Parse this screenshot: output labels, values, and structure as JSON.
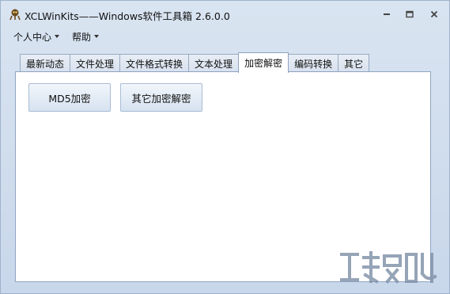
{
  "window": {
    "title": "XCLWinKits——Windows软件工具箱 2.6.0.0"
  },
  "menu": [
    {
      "label": "个人中心"
    },
    {
      "label": "帮助"
    }
  ],
  "tabs": [
    {
      "label": "最新动态"
    },
    {
      "label": "文件处理"
    },
    {
      "label": "文件格式转换"
    },
    {
      "label": "文本处理"
    },
    {
      "label": "加密解密",
      "active": true
    },
    {
      "label": "编码转换"
    },
    {
      "label": "其它"
    }
  ],
  "panel": {
    "buttons": [
      {
        "label": "MD5加密"
      },
      {
        "label": "其它加密解密"
      }
    ]
  },
  "icons": {
    "app": "app-logo-icon",
    "minimize": "minimize-icon",
    "maximize": "maximize-icon",
    "close": "close-icon",
    "watermark": "site-watermark-logo"
  },
  "colors": {
    "window_bg": "#cfdcec",
    "panel_bg": "#ffffff",
    "tab_border": "#8fa4c2"
  }
}
